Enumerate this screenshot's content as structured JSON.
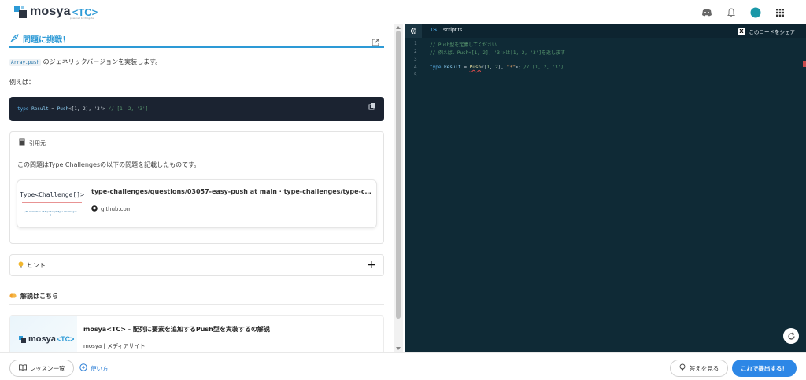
{
  "header": {
    "logo_text": "mosya",
    "logo_tc": "<TC>",
    "logo_sub": "powered by Progate",
    "icons": [
      "discord-icon",
      "bell-icon",
      "avatar",
      "apps-grid-icon"
    ],
    "avatar_color": "#1a98a8"
  },
  "challenge": {
    "heading": "問題に挑戦！",
    "inline_code": "Array.push",
    "description_suffix": " のジェネリックバージョンを実装します。",
    "example_label": "例えば：",
    "code": {
      "kw": "type",
      "name": "Result",
      "eq": " = ",
      "fn": "Push",
      "args": "<[1, 2], '3'>",
      "comment": " // [1, 2, '3']"
    }
  },
  "source": {
    "label": "引用元",
    "description": "この問題はType Challengesの以下の問題を記載したものです。",
    "link_title": "type-challenges/questions/03057-easy-push at main · type-challenges/type-challenge...",
    "link_site": "github.com",
    "thumb_text": "Type<Challenge[]>",
    "thumb_caption": "[ TS Collection of TypeScript Type Challenges ]"
  },
  "hint": {
    "label": "ヒント",
    "toggle": "+"
  },
  "explanation": {
    "heading": "解説はこちら",
    "article_title": "mosya<TC> - 配列に要素を追加するPush型を実装するの解説",
    "article_site": "mosya | メディアサイト",
    "thumb_logo": "mosya",
    "thumb_tc": "<TC>"
  },
  "editor": {
    "lang": "TS",
    "filename": "script.ts",
    "share_label": "このコードをシェア",
    "line_numbers": [
      "1",
      "2",
      "3",
      "4",
      "5"
    ],
    "line1": "// Push型を定義してください",
    "line2": "// 例えば、Push<[1, 2], '3'>は[1, 2, '3']を返します",
    "line4": {
      "kw": "type",
      "name": " Result",
      "eq": " = ",
      "fn": "Push",
      "open": "<[",
      "n1": "1",
      "sep": ", ",
      "n2": "2",
      "mid": "], ",
      "str": "\"3\"",
      "close": ">; ",
      "comment": "// [1, 2, '3']"
    }
  },
  "footer": {
    "lessons_label": "レッスン一覧",
    "howto_label": "使い方",
    "answer_label": "答えを見る",
    "submit_label": "これで提出する！",
    "submit_color": "#2d87e6"
  }
}
